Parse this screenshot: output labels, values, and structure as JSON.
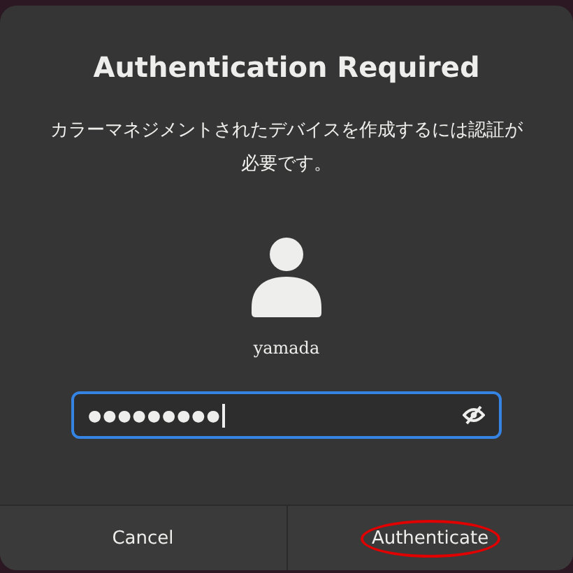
{
  "dialog": {
    "title": "Authentication Required",
    "message": "カラーマネジメントされたデバイスを作成するには認証が必要です。"
  },
  "user": {
    "name": "yamada"
  },
  "password": {
    "value": "●●●●●●●●●",
    "focused": true
  },
  "buttons": [
    {
      "label": "Cancel",
      "circled": false
    },
    {
      "label": "Authenticate",
      "circled": true
    }
  ]
}
